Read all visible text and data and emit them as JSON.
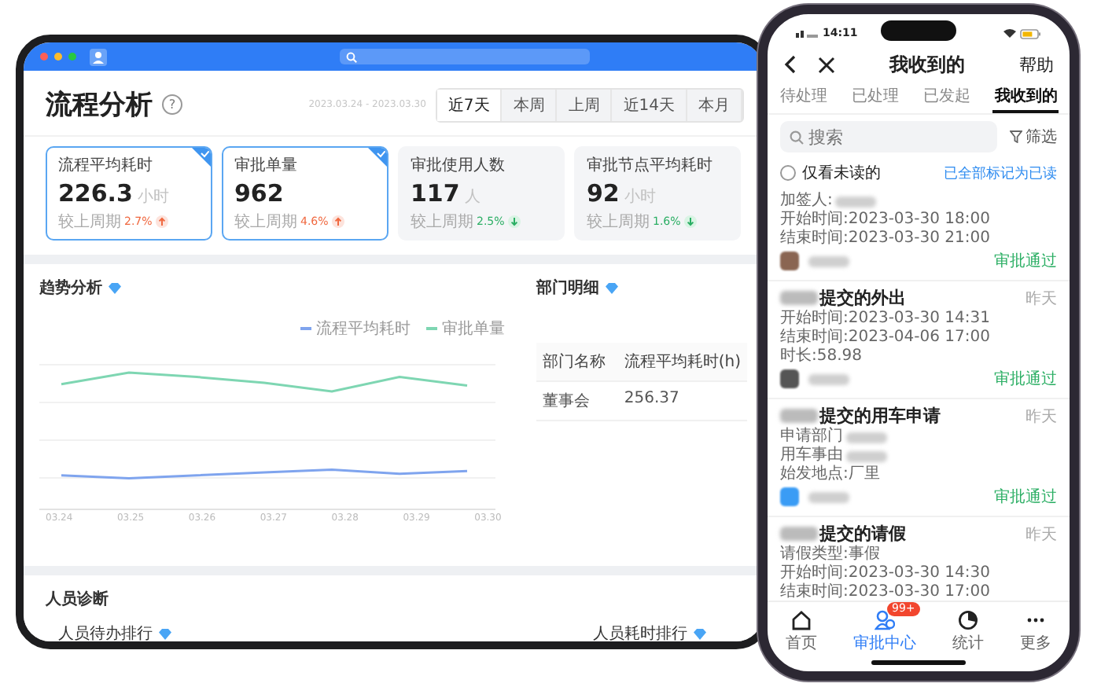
{
  "tablet": {
    "title": "流程分析",
    "help": "?",
    "date_range": "2023.03.24 - 2023.03.30",
    "ranges": [
      {
        "label": "近7天",
        "selected": true
      },
      {
        "label": "本周",
        "selected": false
      },
      {
        "label": "上周",
        "selected": false
      },
      {
        "label": "近14天",
        "selected": false
      },
      {
        "label": "本月",
        "selected": false
      }
    ],
    "metrics": [
      {
        "label": "流程平均耗时",
        "value": "226.3",
        "unit": "小时",
        "compare": "较上周期",
        "change": "2.7%",
        "up": true,
        "selected": true
      },
      {
        "label": "审批单量",
        "value": "962",
        "compare": "较上周期",
        "change": "4.6%",
        "up": true,
        "selected": true
      },
      {
        "label": "审批使用人数",
        "value": "117",
        "unit": "人",
        "compare": "较上周期",
        "change": "2.5%",
        "up": false,
        "selected": false
      },
      {
        "label": "审批节点平均耗时",
        "value": "92",
        "unit": "小时",
        "compare": "较上周期",
        "change": "1.6%",
        "up": false,
        "selected": false
      }
    ],
    "trend": {
      "title": "趋势分析",
      "legend": [
        {
          "name": "流程平均耗时",
          "color": "#7fa4ee"
        },
        {
          "name": "审批单量",
          "color": "#7ed6b2"
        }
      ],
      "x_labels": [
        "03.24",
        "03.25",
        "03.26",
        "03.27",
        "03.28",
        "03.29",
        "03.30"
      ]
    },
    "departments": {
      "title": "部门明细",
      "columns": [
        "部门名称",
        "流程平均耗时(h)"
      ],
      "rows": [
        [
          "董事会",
          "256.37"
        ]
      ]
    },
    "staff": {
      "title": "人员诊断",
      "rankings": [
        "人员待办排行",
        "人员耗时排行"
      ]
    }
  },
  "phone": {
    "time": "14:11",
    "title": "我收到的",
    "help": "帮助",
    "tabs": [
      {
        "label": "待处理",
        "selected": false
      },
      {
        "label": "已处理",
        "selected": false
      },
      {
        "label": "已发起",
        "selected": false
      },
      {
        "label": "我收到的",
        "selected": true
      }
    ],
    "search": {
      "placeholder": "搜索"
    },
    "filter": "筛选",
    "unread_only": {
      "label": "仅看未读的",
      "checked": false
    },
    "mark_all_read": "已全部标记为已读",
    "items": [
      {
        "lines": [
          {
            "text": "加签人:",
            "redacted": true
          },
          {
            "text": "开始时间:2023-03-30 18:00",
            "redacted": false
          },
          {
            "text": "结束时间:2023-03-30 21:00",
            "redacted": false
          }
        ],
        "status": "审批通过",
        "color": "#8a6552"
      },
      {
        "title": "提交的外出",
        "when": "昨天",
        "lines": [
          {
            "text": "开始时间:2023-03-30 14:31",
            "redacted": false
          },
          {
            "text": "结束时间:2023-04-06 17:00",
            "redacted": false
          },
          {
            "text": "时长:58.98",
            "redacted": false
          }
        ],
        "status": "审批通过",
        "color": "#555555"
      },
      {
        "title": "提交的用车申请",
        "when": "昨天",
        "lines": [
          {
            "text": "申请部门",
            "redacted": true
          },
          {
            "text": "用车事由",
            "redacted": true
          },
          {
            "text": "始发地点:厂里",
            "redacted": false
          }
        ],
        "status": "审批通过",
        "color": "#3a9cf5"
      },
      {
        "title": "提交的请假",
        "when": "昨天",
        "lines": [
          {
            "text": "请假类型:事假",
            "redacted": false
          },
          {
            "text": "开始时间:2023-03-30 14:30",
            "redacted": false
          },
          {
            "text": "结束时间:2023-03-30 17:00",
            "redacted": false
          }
        ]
      }
    ],
    "nav": [
      {
        "label": "首页",
        "kind": "home",
        "selected": false
      },
      {
        "label": "审批中心",
        "kind": "approval",
        "selected": true,
        "badge": "99+"
      },
      {
        "label": "统计",
        "kind": "stats",
        "selected": false
      },
      {
        "label": "更多",
        "kind": "more",
        "selected": false
      }
    ]
  }
}
